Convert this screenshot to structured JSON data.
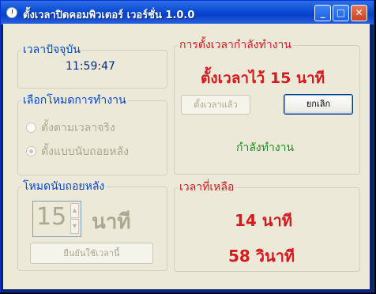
{
  "window": {
    "title": "ตั้งเวลาปิดคอมพิวเตอร์ เวอร์ชั่น 1.0.0",
    "minimize_label": "_",
    "maximize_label": "□",
    "close_label": "✕"
  },
  "current_time": {
    "legend": "เวลาปัจจุบัน",
    "value": "11:59:47"
  },
  "mode": {
    "legend": "เลือกโหมดการทำงาน",
    "options": [
      {
        "label": "ตั้งตามเวลาจริง",
        "selected": false
      },
      {
        "label": "ตั้งแบบนับถอยหลัง",
        "selected": true
      }
    ]
  },
  "countdown": {
    "legend": "โหมดนับถอยหลัง",
    "value": "15",
    "unit": "นาที",
    "confirm_label": "ยืนยันใช้เวลานี้"
  },
  "status": {
    "legend": "การตั้งเวลากำลังทำงาน",
    "set_text": "ตั้งเวลาไว้ 15 นาที",
    "set_button": "ตั้งเวลาแล้ว",
    "cancel_button": "ยกเลิก",
    "working_text": "กำลังทำงาน"
  },
  "remaining": {
    "legend": "เวลาที่เหลือ",
    "minutes_text": "14 นาที",
    "seconds_text": "58 วินาที"
  },
  "colors": {
    "legend_blue": "#0046d5",
    "alert_red": "#d7191f",
    "working_green": "#1b8f1b",
    "titlebar_blue": "#0a4bd6"
  }
}
